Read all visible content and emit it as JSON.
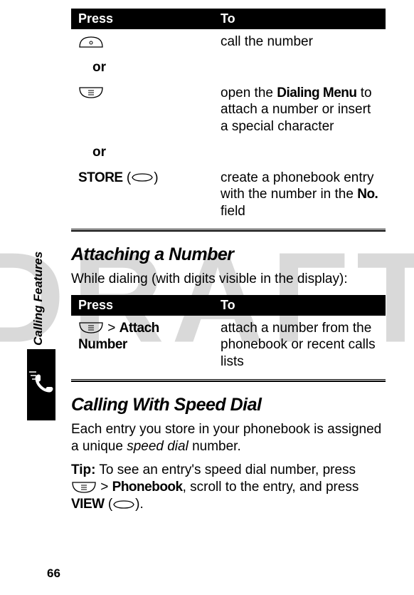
{
  "watermark": "DRAFT",
  "sidebar": {
    "label": "Calling Features"
  },
  "page_number": "66",
  "table1": {
    "header": {
      "press": "Press",
      "to": "To"
    },
    "rows": {
      "r1": {
        "left": "",
        "right": "call the number"
      },
      "or1": "or",
      "r2": {
        "left": "",
        "right_pre": "open the ",
        "right_menu": "Dialing Menu",
        "right_post": " to attach a number or insert a special character"
      },
      "or2": "or",
      "r3": {
        "left_label": "STORE",
        "left_paren_open": " (",
        "left_paren_close": ")",
        "right_pre": "create a phonebook entry with the number in the ",
        "right_menu": "No.",
        "right_post": " field"
      }
    }
  },
  "sec_attach": {
    "heading": "Attaching a Number",
    "intro": "While dialing (with digits visible in the display):"
  },
  "table2": {
    "header": {
      "press": "Press",
      "to": "To"
    },
    "rows": {
      "r1": {
        "left_gt": " > ",
        "left_menu": "Attach Number",
        "right": "attach a number from the phonebook or recent calls lists"
      }
    }
  },
  "sec_speed": {
    "heading": "Calling With Speed Dial",
    "p1": "Each entry you store in your phonebook is assigned a unique ",
    "p1_em": "speed dial",
    "p1_post": " number.",
    "tip_label": "Tip:",
    "tip_text": " To see an entry's speed dial number, press ",
    "tip_gt": " > ",
    "tip_menu": "Phonebook",
    "tip_mid": ", scroll to the entry, and press ",
    "tip_view": "VIEW",
    "tip_paren_open": " (",
    "tip_paren_close": ")."
  }
}
